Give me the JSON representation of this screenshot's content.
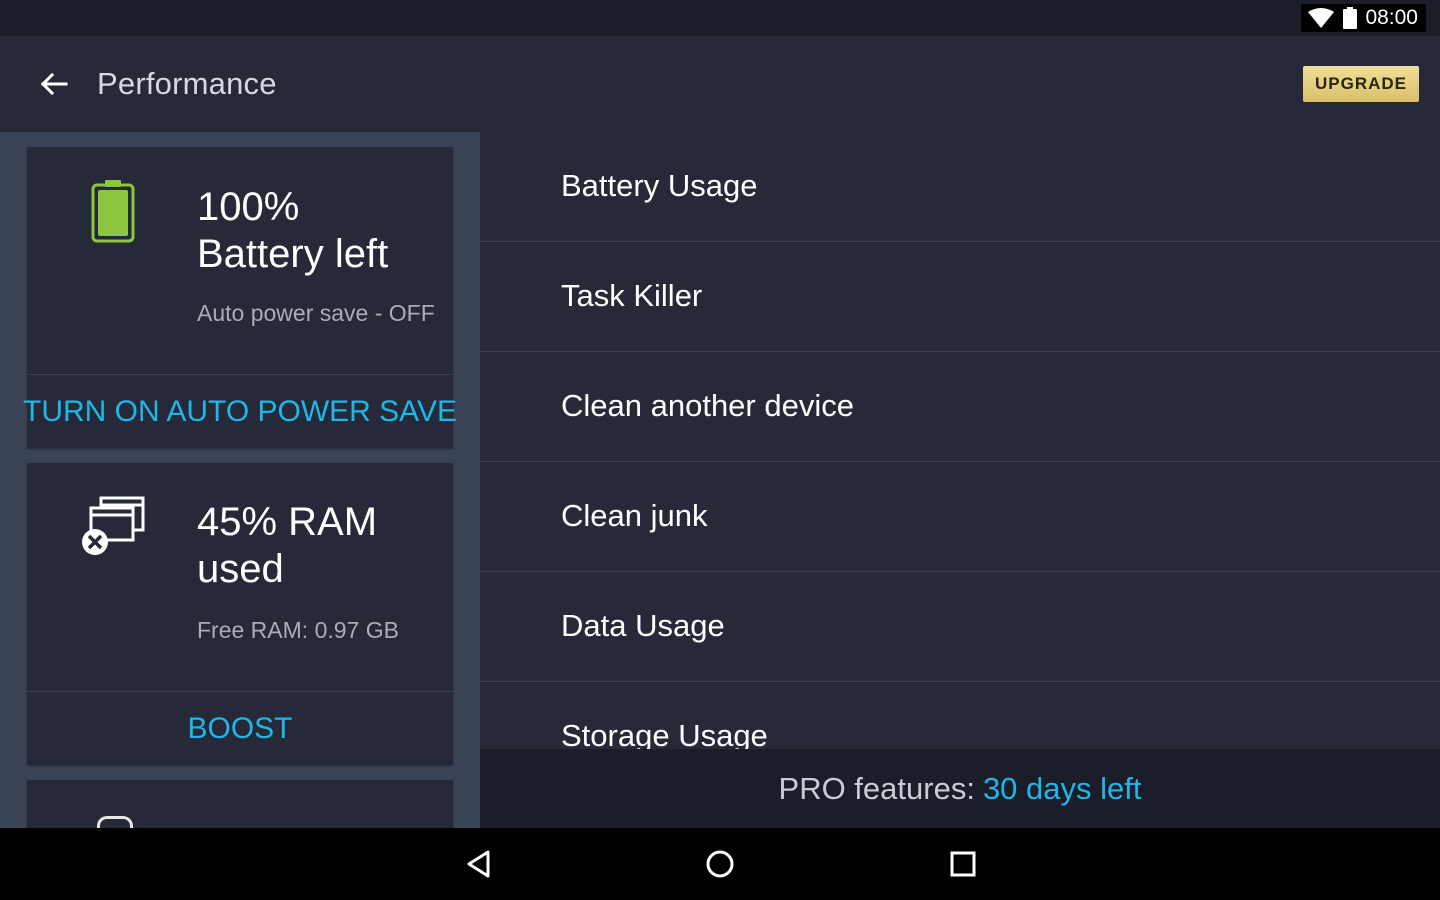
{
  "status_bar": {
    "time": "08:00",
    "icons": [
      "wifi-icon",
      "battery-icon"
    ]
  },
  "app_bar": {
    "title": "Performance",
    "back_icon": "arrow-left-icon",
    "upgrade_label": "UPGRADE"
  },
  "cards": {
    "battery": {
      "icon": "battery-full-icon",
      "level_percent": 100,
      "headline_line1": "100%",
      "headline_line2": "Battery left",
      "sub": "Auto power save - OFF",
      "action": "TURN ON AUTO POWER SAVE"
    },
    "ram": {
      "icon": "close-windows-icon",
      "headline_line1": "45% RAM",
      "headline_line2": "used",
      "sub": "Free RAM: 0.97 GB",
      "action": "BOOST"
    }
  },
  "menu": {
    "items": [
      {
        "label": "Battery Usage"
      },
      {
        "label": "Task Killer"
      },
      {
        "label": "Clean another device"
      },
      {
        "label": "Clean junk"
      },
      {
        "label": "Data Usage"
      },
      {
        "label": "Storage Usage"
      }
    ]
  },
  "pro_footer": {
    "label": "PRO features:",
    "days": "30 days left"
  },
  "nav_bar": {
    "icons": [
      "nav-back-icon",
      "nav-home-icon",
      "nav-recents-icon"
    ]
  },
  "colors": {
    "accent": "#1fb6e8",
    "battery_green": "#8dc63f",
    "upgrade_gold": "#e6d083",
    "background": "#262a38"
  }
}
